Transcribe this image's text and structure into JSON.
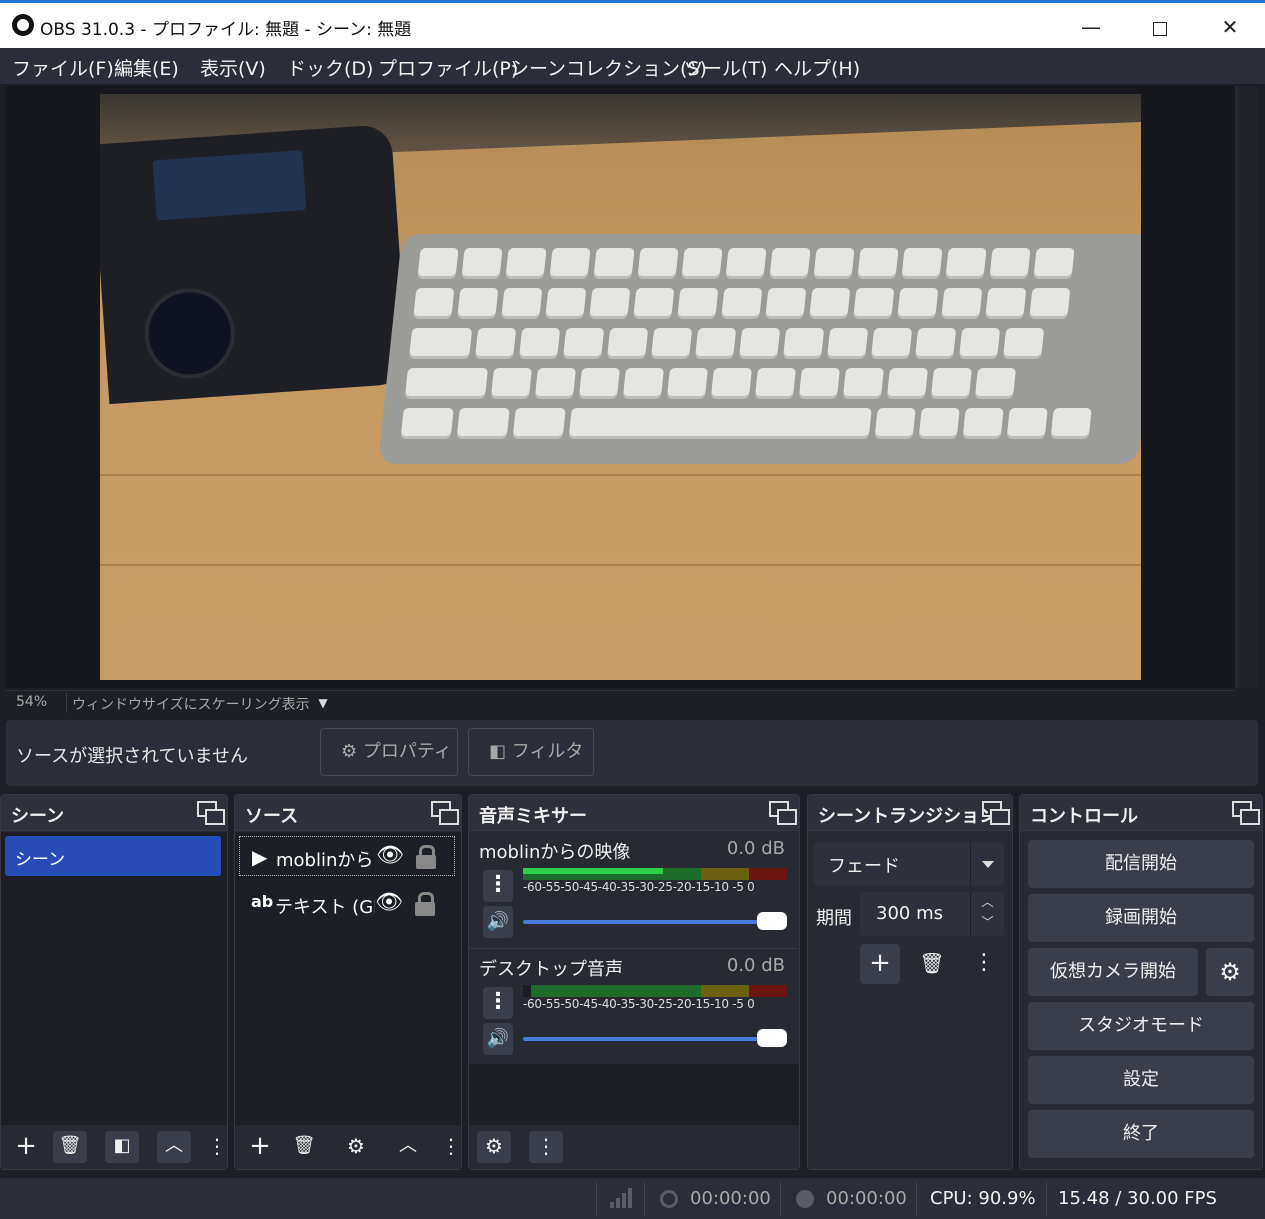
{
  "window": {
    "title": "OBS 31.0.3 - プロファイル: 無題 - シーン: 無題",
    "minimize": "—",
    "close": "✕"
  },
  "menu": [
    "ファイル(F)",
    "編集(E)",
    "表示(V)",
    "ドック(D)",
    "プロファイル(P)",
    "シーンコレクション(S)",
    "ツール(T)",
    "ヘルプ(H)"
  ],
  "preview": {
    "zoom": "54%",
    "scale_mode": "ウィンドウサイズにスケーリング表示",
    "dropdown_glyph": "▼"
  },
  "context": {
    "no_selection": "ソースが選択されていません",
    "properties": "プロパティ",
    "filters": "フィルタ"
  },
  "scenes": {
    "title": "シーン",
    "items": [
      "シーン"
    ]
  },
  "sources": {
    "title": "ソース",
    "items": [
      {
        "icon": "▶",
        "label": "moblinから"
      },
      {
        "icon": "ab",
        "label": "テキスト (GD"
      }
    ]
  },
  "mixer": {
    "title": "音声ミキサー",
    "ticks": "-60-55-50-45-40-35-30-25-20-15-10 -5  0",
    "channels": [
      {
        "name": "moblinからの映像",
        "db": "0.0 dB",
        "level": 0.53
      },
      {
        "name": "デスクトップ音声",
        "db": "0.0 dB",
        "level": 0.0
      }
    ]
  },
  "transitions": {
    "title": "シーントランジション",
    "selected": "フェード",
    "duration_label": "期間",
    "duration": "300 ms"
  },
  "controls": {
    "title": "コントロール",
    "start_stream": "配信開始",
    "start_record": "録画開始",
    "virtual_cam": "仮想カメラ開始",
    "studio_mode": "スタジオモード",
    "settings": "設定",
    "exit": "終了"
  },
  "status": {
    "stream_time": "00:00:00",
    "record_time": "00:00:00",
    "cpu": "CPU: 90.9%",
    "fps": "15.48 / 30.00 FPS"
  },
  "colors": {
    "accent": "#284cb8",
    "meter_green": "#2fd14a",
    "meter_yellow": "#8a7a12",
    "meter_red": "#8a1a1a"
  }
}
